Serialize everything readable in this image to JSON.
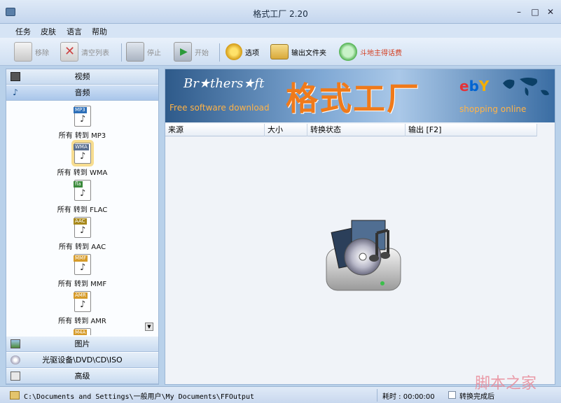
{
  "window": {
    "title": "格式工厂 2.20",
    "minimize": "–",
    "maximize": "□",
    "close": "✕"
  },
  "menu": [
    "任务",
    "皮肤",
    "语言",
    "帮助"
  ],
  "toolbar": {
    "remove": "移除",
    "clear": "清空列表",
    "stop": "停止",
    "start": "开始",
    "options": "选项",
    "output_folder": "输出文件夹",
    "earn": "斗地主得话费"
  },
  "sidebar": {
    "categories": {
      "video": "视频",
      "audio": "音频",
      "picture": "图片",
      "rom": "光驱设备\\DVD\\CD\\ISO",
      "advanced": "高级"
    },
    "formats": [
      {
        "tag": "MP3",
        "label": "所有 转到 MP3",
        "color": "#2d6fb8"
      },
      {
        "tag": "WMA",
        "label": "所有 转到 WMA",
        "color": "#5a6f8f",
        "selected": true
      },
      {
        "tag": "fla",
        "label": "所有 转到 FLAC",
        "color": "#3c8a3c"
      },
      {
        "tag": "AAC",
        "label": "所有 转到 AAC",
        "color": "#a8891c"
      },
      {
        "tag": "MMF",
        "label": "所有 转到 MMF",
        "color": "#d69b2a"
      },
      {
        "tag": "AMR",
        "label": "所有 转到 AMR",
        "color": "#d69b2a"
      },
      {
        "tag": "M4A",
        "label": "",
        "color": "#d69b2a"
      }
    ]
  },
  "banner": {
    "brand": "Br★thers★ft",
    "free": "Free software download",
    "title": "格式工厂",
    "ebay": [
      "e",
      "b",
      "Y"
    ],
    "shop": "shopping online"
  },
  "table": {
    "columns": [
      "来源",
      "大小",
      "转换状态",
      "输出 [F2]"
    ]
  },
  "status": {
    "path": "C:\\Documents and Settings\\一般用户\\My Documents\\FFOutput",
    "elapsed": "耗时 : 00:00:00",
    "after": "转换完成后"
  },
  "watermark": "脚本之家"
}
